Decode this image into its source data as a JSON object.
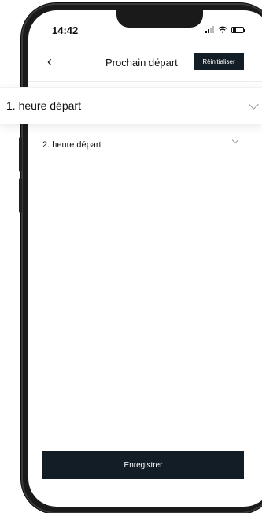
{
  "status_bar": {
    "time": "14:42",
    "icons": [
      "signal-icon",
      "wifi-icon",
      "battery-icon"
    ]
  },
  "nav": {
    "back_icon": "chevron-left-icon",
    "title": "Prochain départ",
    "reset_label": "Réinitialiser"
  },
  "rows": [
    {
      "label": "1. heure départ",
      "expanded": true,
      "icon": "chevron-down-icon"
    },
    {
      "label": "2. heure départ",
      "expanded": false,
      "icon": "chevron-down-icon"
    }
  ],
  "save_label": "Enregistrer",
  "colors": {
    "primary_button": "#121d26",
    "text": "#111111",
    "background": "#ffffff"
  }
}
